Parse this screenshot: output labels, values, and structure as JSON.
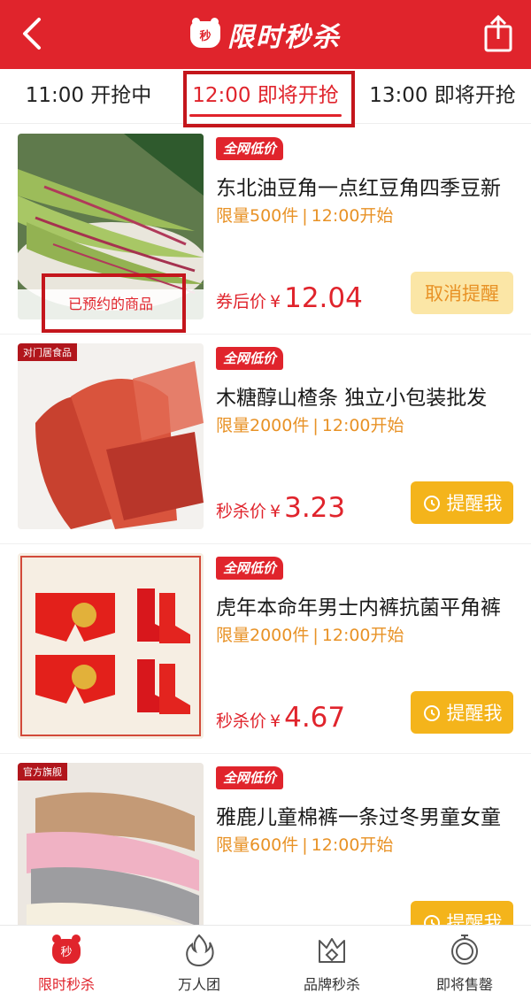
{
  "header": {
    "title": "限时秒杀",
    "badge": "秒"
  },
  "tabs": [
    {
      "label": "11:00 开抢中"
    },
    {
      "label": "12:00 即将开抢"
    },
    {
      "label": "13:00 即将开抢"
    }
  ],
  "products": [
    {
      "tag": "全网低价",
      "name": "东北油豆角一点红豆角四季豆新",
      "limit": "限量500件",
      "time": "12:00开始",
      "price_label": "券后价",
      "currency": "¥",
      "price": "12.04",
      "button": "取消提醒",
      "reserved": "已预约的商品"
    },
    {
      "tag": "全网低价",
      "name": "木糖醇山楂条 独立小包装批发",
      "limit": "限量2000件",
      "time": "12:00开始",
      "price_label": "秒杀价",
      "currency": "¥",
      "price": "3.23",
      "button": "提醒我",
      "shop": "对门居食品"
    },
    {
      "tag": "全网低价",
      "name": "虎年本命年男士内裤抗菌平角裤",
      "limit": "限量2000件",
      "time": "12:00开始",
      "price_label": "秒杀价",
      "currency": "¥",
      "price": "4.67",
      "button": "提醒我"
    },
    {
      "tag": "全网低价",
      "name": "雅鹿儿童棉裤一条过冬男童女童",
      "limit": "限量600件",
      "time": "12:00开始",
      "button": "提醒我",
      "shop": "官方旗舰"
    }
  ],
  "bottom_nav": [
    {
      "label": "限时秒杀",
      "icon": "flash-sale-icon",
      "badge": "秒"
    },
    {
      "label": "万人团",
      "icon": "flame-icon"
    },
    {
      "label": "品牌秒杀",
      "icon": "crown-tag-icon"
    },
    {
      "label": "即将售罄",
      "icon": "stopwatch-icon"
    }
  ],
  "colors": {
    "primary": "#e0242c",
    "button": "#f4b41b",
    "meta": "#e89226"
  }
}
